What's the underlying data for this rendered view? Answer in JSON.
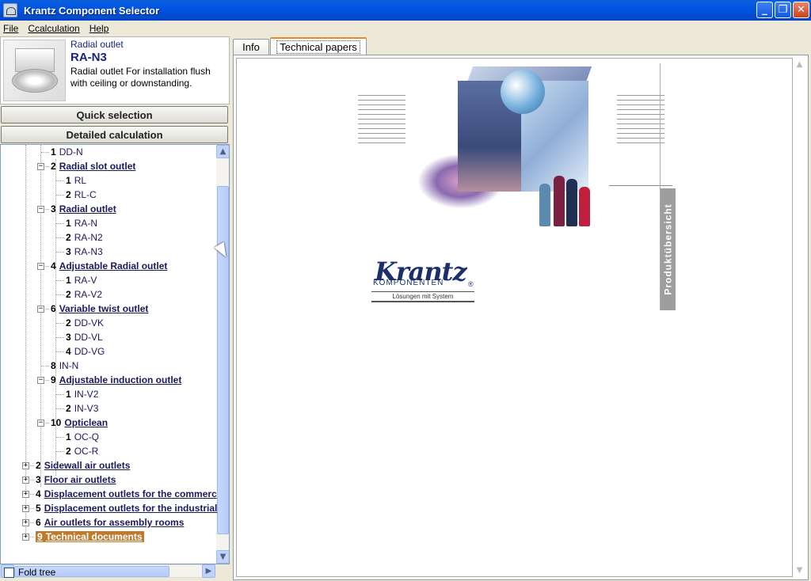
{
  "window": {
    "title": "Krantz Component Selector",
    "minimize": "_",
    "restore": "❐",
    "close": "✕"
  },
  "menu": [
    "File",
    "Ccalculation",
    "Help"
  ],
  "product": {
    "category": "Radial outlet",
    "code": "RA-N3",
    "description": "Radial outlet For installation flush with ceiling or downstanding."
  },
  "buttons": {
    "quick": "Quick selection",
    "detailed": "Detailed calculation"
  },
  "tree": [
    {
      "num": "1",
      "label": "DD-N",
      "level": 1,
      "group": false
    },
    {
      "num": "2",
      "label": "Radial slot outlet",
      "level": 1,
      "group": true
    },
    {
      "num": "1",
      "label": "RL",
      "level": 2,
      "group": false
    },
    {
      "num": "2",
      "label": "RL-C",
      "level": 2,
      "group": false
    },
    {
      "num": "3",
      "label": "Radial outlet",
      "level": 1,
      "group": true
    },
    {
      "num": "1",
      "label": "RA-N",
      "level": 2,
      "group": false
    },
    {
      "num": "2",
      "label": "RA-N2",
      "level": 2,
      "group": false
    },
    {
      "num": "3",
      "label": "RA-N3",
      "level": 2,
      "group": false
    },
    {
      "num": "4",
      "label": "Adjustable Radial outlet",
      "level": 1,
      "group": true
    },
    {
      "num": "1",
      "label": "RA-V",
      "level": 2,
      "group": false
    },
    {
      "num": "2",
      "label": "RA-V2",
      "level": 2,
      "group": false
    },
    {
      "num": "6",
      "label": "Variable twist outlet",
      "level": 1,
      "group": true
    },
    {
      "num": "2",
      "label": "DD-VK",
      "level": 2,
      "group": false
    },
    {
      "num": "3",
      "label": "DD-VL",
      "level": 2,
      "group": false
    },
    {
      "num": "4",
      "label": "DD-VG",
      "level": 2,
      "group": false
    },
    {
      "num": "8",
      "label": "IN-N",
      "level": 1,
      "group": false
    },
    {
      "num": "9",
      "label": "Adjustable induction outlet",
      "level": 1,
      "group": true
    },
    {
      "num": "1",
      "label": "IN-V2",
      "level": 2,
      "group": false
    },
    {
      "num": "2",
      "label": "IN-V3",
      "level": 2,
      "group": false
    },
    {
      "num": "10",
      "label": "Opticlean",
      "level": 1,
      "group": true
    },
    {
      "num": "1",
      "label": "OC-Q",
      "level": 2,
      "group": false
    },
    {
      "num": "2",
      "label": "OC-R",
      "level": 2,
      "group": false
    },
    {
      "num": "2",
      "label": "Sidewall air outlets",
      "level": 0,
      "group": true
    },
    {
      "num": "3",
      "label": "Floor air outlets",
      "level": 0,
      "group": true
    },
    {
      "num": "4",
      "label": "Displacement outlets for the commerc",
      "level": 0,
      "group": true
    },
    {
      "num": "5",
      "label": "Displacement outlets for the industrial",
      "level": 0,
      "group": true
    },
    {
      "num": "6",
      "label": "Air outlets for assembly rooms",
      "level": 0,
      "group": true
    },
    {
      "num": "9",
      "label": "Technical documents",
      "level": 0,
      "group": true,
      "selected": true
    }
  ],
  "fold_tree": "Fold tree",
  "tabs": {
    "info": "Info",
    "papers": "Technical papers",
    "active": "papers"
  },
  "document": {
    "logo_script": "Krantz",
    "logo_sub": "KOMPONENTEN",
    "logo_reg": "®",
    "logo_tagline": "Lösungen mit System",
    "side_label": "Produktübersicht"
  },
  "colors": {
    "selected": "#c07a2c",
    "titlebar": "#0054e3",
    "link": "#1a1a5a"
  }
}
